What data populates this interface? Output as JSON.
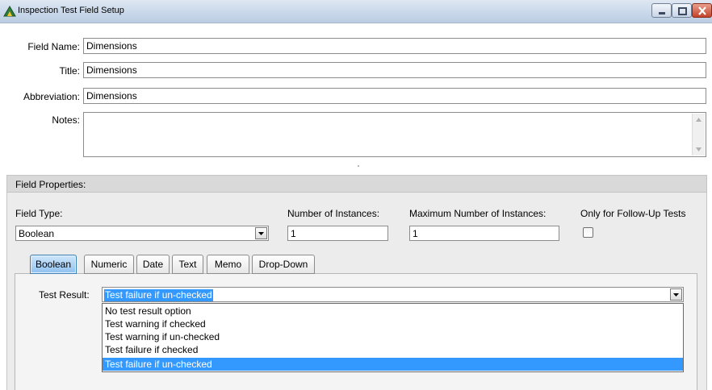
{
  "window": {
    "title": "Inspection Test Field Setup",
    "icon": "app-icon"
  },
  "form": {
    "field_name": {
      "label": "Field Name:",
      "value": "Dimensions"
    },
    "title": {
      "label": "Title:",
      "value": "Dimensions"
    },
    "abbreviation": {
      "label": "Abbreviation:",
      "value": "Dimensions"
    },
    "notes": {
      "label": "Notes:",
      "value": ""
    }
  },
  "field_properties": {
    "header": "Field Properties:",
    "field_type": {
      "label": "Field Type:",
      "value": "Boolean"
    },
    "number_of_instances": {
      "label": "Number of Instances:",
      "value": "1"
    },
    "maximum_number_of_instances": {
      "label": "Maximum Number of Instances:",
      "value": "1"
    },
    "only_follow_up": {
      "label": "Only for Follow-Up Tests",
      "checked": false
    },
    "tabs": [
      {
        "label": "Boolean",
        "active": true
      },
      {
        "label": "Numeric",
        "active": false
      },
      {
        "label": "Date",
        "active": false
      },
      {
        "label": "Text",
        "active": false
      },
      {
        "label": "Memo",
        "active": false
      },
      {
        "label": "Drop-Down",
        "active": false
      }
    ],
    "test_result": {
      "label": "Test Result:",
      "value": "Test failure if un-checked",
      "options": [
        "No test result option",
        "Test warning if checked",
        "Test warning if un-checked",
        "Test failure if checked",
        "Test failure if un-checked"
      ],
      "selected_index": 4
    }
  },
  "colors": {
    "selection": "#3399ff",
    "titlebar": "#c9d8ea",
    "panel": "#ececec",
    "active_tab": "#8fc1ef"
  }
}
